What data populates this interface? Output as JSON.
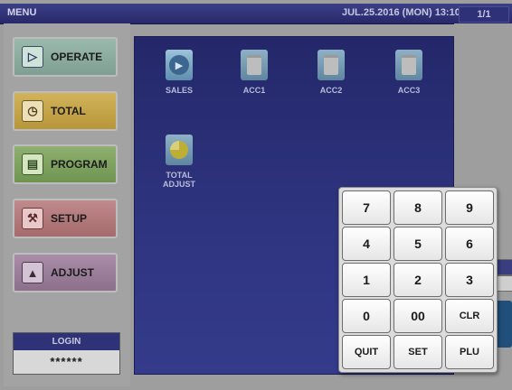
{
  "topbar": {
    "menu_label": "MENU",
    "datetime": "JUL.25.2016 (MON) 13:10",
    "page_indicator": "1/1"
  },
  "sidebar": {
    "items": [
      {
        "label": "OPERATE",
        "icon": "play-circle-icon"
      },
      {
        "label": "TOTAL",
        "icon": "clock-icon"
      },
      {
        "label": "PROGRAM",
        "icon": "book-icon"
      },
      {
        "label": "SETUP",
        "icon": "wrench-icon"
      },
      {
        "label": "ADJUST",
        "icon": "slider-icon"
      }
    ],
    "login": {
      "title": "LOGIN",
      "password": "******"
    }
  },
  "main": {
    "apps": [
      {
        "label": "SALES",
        "icon": "play-icon"
      },
      {
        "label": "ACC1",
        "icon": "trash-icon"
      },
      {
        "label": "ACC2",
        "icon": "trash-icon"
      },
      {
        "label": "ACC3",
        "icon": "trash-icon"
      },
      {
        "label_line1": "TOTAL",
        "label_line2": "ADJUST",
        "icon": "pie-chart-icon"
      }
    ]
  },
  "keypad": {
    "keys": [
      "7",
      "8",
      "9",
      "4",
      "5",
      "6",
      "1",
      "2",
      "3",
      "0",
      "00",
      "CLR",
      "QUIT",
      "SET",
      "PLU"
    ]
  },
  "colors": {
    "title_bar": "#2b2e70",
    "main_panel": "#2f3581",
    "keypad_bg": "#dcdcdc"
  }
}
